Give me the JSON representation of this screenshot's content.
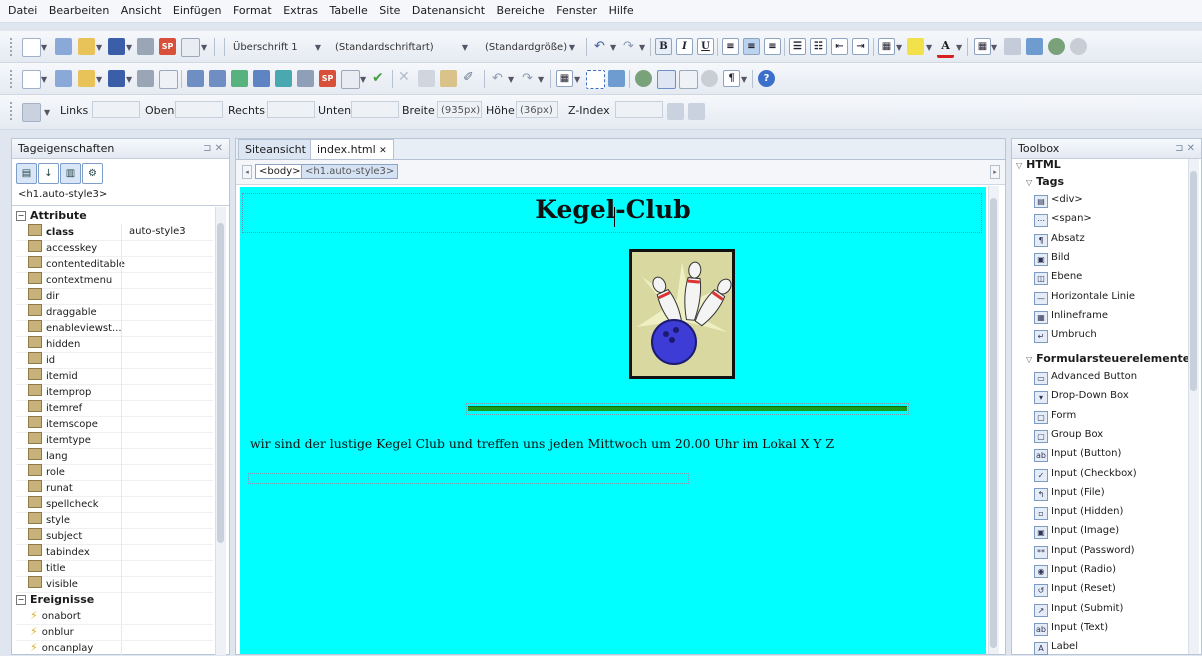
{
  "menu": [
    "Datei",
    "Bearbeiten",
    "Ansicht",
    "Einfügen",
    "Format",
    "Extras",
    "Tabelle",
    "Site",
    "Datenansicht",
    "Bereiche",
    "Fenster",
    "Hilfe"
  ],
  "toolbar1": {
    "paragraph_style": "Überschrift 1",
    "font_family": "(Standardschriftart)",
    "font_size": "(Standardgröße)"
  },
  "positionbar": {
    "links": "Links",
    "oben": "Oben",
    "rechts": "Rechts",
    "unten": "Unten",
    "breite_label": "Breite",
    "breite_value": "(935px)",
    "hoehe_label": "Höhe",
    "hoehe_value": "(36px)",
    "zindex": "Z-Index"
  },
  "left_panel": {
    "title": "Tageigenschaften",
    "selected_tag": "<h1.auto-style3>",
    "attributes_header": "Attribute",
    "class_row": {
      "name": "class",
      "value": "auto-style3"
    },
    "attributes": [
      "accesskey",
      "contenteditable",
      "contextmenu",
      "dir",
      "draggable",
      "enableviewst...",
      "hidden",
      "id",
      "itemid",
      "itemprop",
      "itemref",
      "itemscope",
      "itemtype",
      "lang",
      "role",
      "runat",
      "spellcheck",
      "style",
      "subject",
      "tabindex",
      "title",
      "visible"
    ],
    "events_header": "Ereignisse",
    "events": [
      "onabort",
      "onblur",
      "oncanplay"
    ]
  },
  "center": {
    "tab_site": "Siteansicht",
    "tab_file": "index.html",
    "breadcrumb": [
      "<body>",
      "<h1.auto-style3>"
    ],
    "heading": "Kegel-Club",
    "body_text": "wir sind der lustige Kegel Club und treffen  uns jeden Mittwoch um 20.00 Uhr im Lokal X Y Z",
    "page_bg": "#00ffff",
    "rule_color": "#1a9a1a"
  },
  "toolbox": {
    "title": "Toolbox",
    "html_header": "HTML",
    "tags_header": "Tags",
    "tags": [
      {
        "label": "<div>",
        "icon": "div-icon"
      },
      {
        "label": "<span>",
        "icon": "span-icon"
      },
      {
        "label": "Absatz",
        "icon": "paragraph-icon"
      },
      {
        "label": "Bild",
        "icon": "image-icon"
      },
      {
        "label": "Ebene",
        "icon": "layer-icon"
      },
      {
        "label": "Horizontale Linie",
        "icon": "hr-icon"
      },
      {
        "label": "Inlineframe",
        "icon": "iframe-icon"
      },
      {
        "label": "Umbruch",
        "icon": "break-icon"
      }
    ],
    "form_header": "Formularsteuerelemente",
    "form_items": [
      {
        "label": "Advanced Button",
        "icon": "advanced-button-icon"
      },
      {
        "label": "Drop-Down Box",
        "icon": "dropdown-icon"
      },
      {
        "label": "Form",
        "icon": "form-icon"
      },
      {
        "label": "Group Box",
        "icon": "groupbox-icon"
      },
      {
        "label": "Input (Button)",
        "icon": "input-button-icon"
      },
      {
        "label": "Input (Checkbox)",
        "icon": "checkbox-icon"
      },
      {
        "label": "Input (File)",
        "icon": "file-icon"
      },
      {
        "label": "Input (Hidden)",
        "icon": "hidden-icon"
      },
      {
        "label": "Input (Image)",
        "icon": "input-image-icon"
      },
      {
        "label": "Input (Password)",
        "icon": "password-icon"
      },
      {
        "label": "Input (Radio)",
        "icon": "radio-icon"
      },
      {
        "label": "Input (Reset)",
        "icon": "reset-icon"
      },
      {
        "label": "Input (Submit)",
        "icon": "submit-icon"
      },
      {
        "label": "Input (Text)",
        "icon": "text-input-icon"
      },
      {
        "label": "Label",
        "icon": "label-icon"
      }
    ]
  }
}
